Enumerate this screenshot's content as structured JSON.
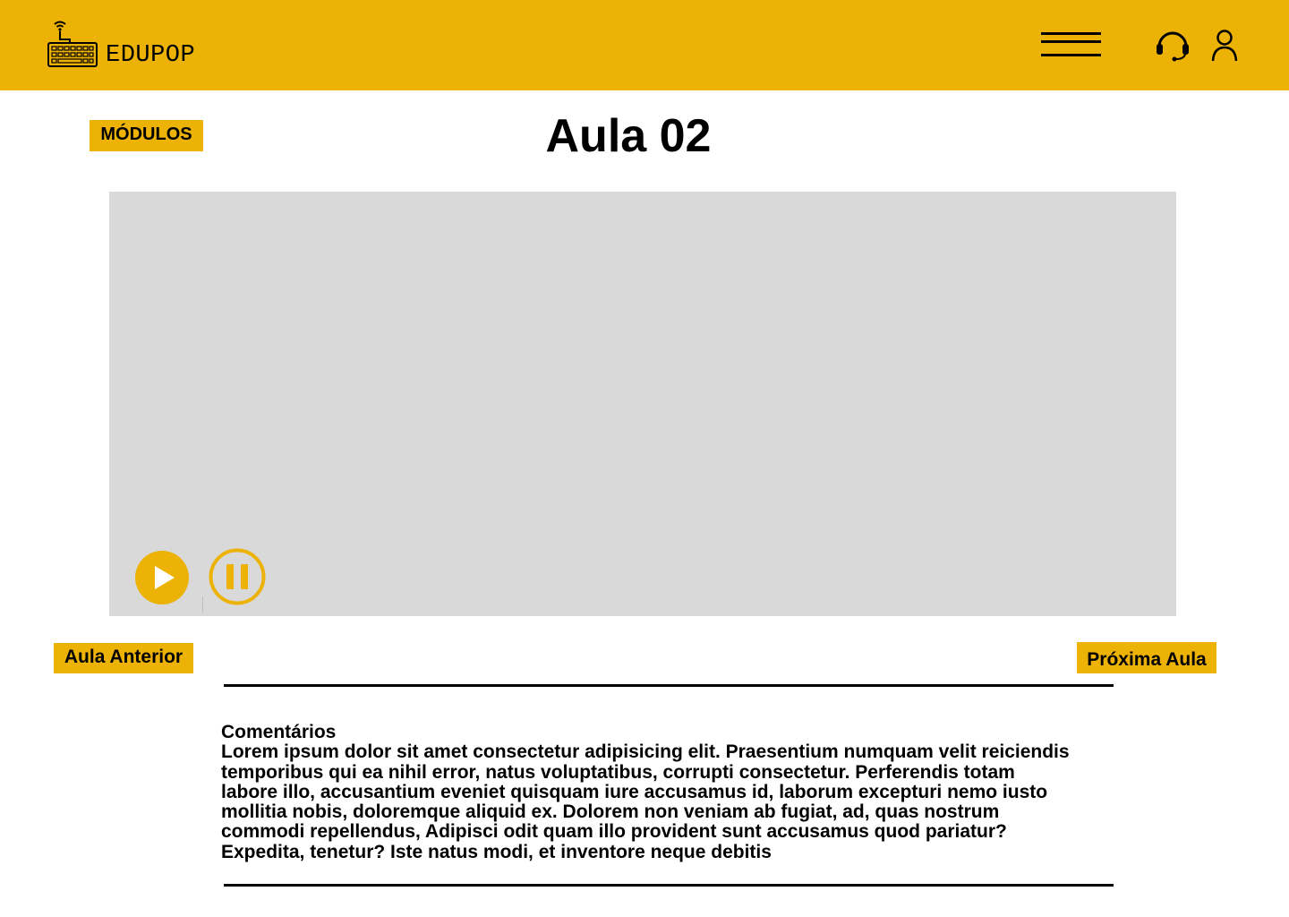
{
  "header": {
    "brand": "EDUPOP",
    "menu_icon": "hamburger-menu-icon",
    "support_icon": "headset-icon",
    "profile_icon": "user-icon"
  },
  "nav": {
    "modules_label": "MÓDULOS",
    "previous_label": "Aula Anterior",
    "next_label": "Próxima Aula"
  },
  "lesson": {
    "title": "Aula 02"
  },
  "video": {
    "play_icon": "play-icon",
    "pause_icon": "pause-icon"
  },
  "comments": {
    "heading": "Comentários",
    "body": "Lorem ipsum dolor sit amet consectetur adipisicing elit. Praesentium numquam velit reiciendis\n temporibus qui ea nihil error, natus voluptatibus, corrupti consectetur. Perferendis totam\nlabore illo, accusantium eveniet quisquam iure accusamus id, laborum excepturi nemo iusto\n mollitia nobis, doloremque aliquid ex. Dolorem non veniam ab fugiat, ad, quas nostrum\ncommodi repellendus, Adipisci odit quam illo provident sunt accusamus quod pariatur?\nExpedita, tenetur? Iste natus modi, et inventore neque debitis"
  },
  "colors": {
    "brand_yellow": "#ECB206",
    "video_placeholder": "#D9D9D9",
    "text": "#000000"
  }
}
